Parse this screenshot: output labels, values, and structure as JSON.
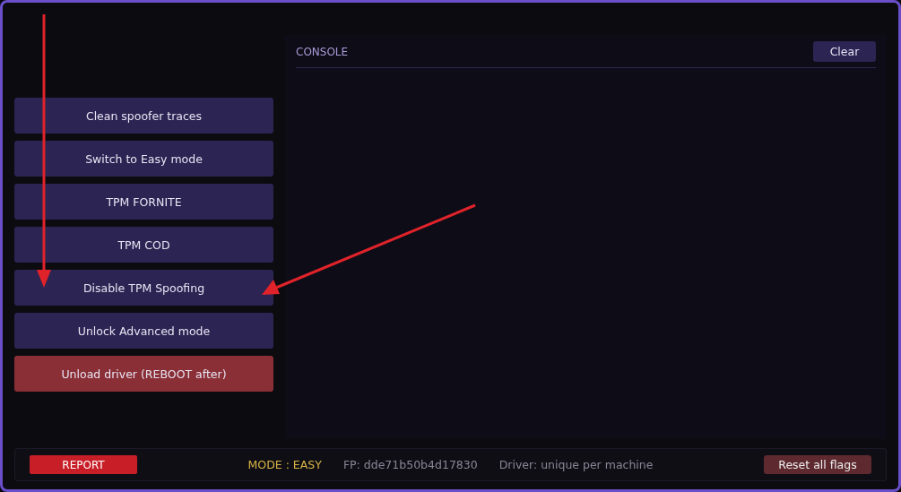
{
  "actions": [
    {
      "label": "Clean spoofer traces",
      "kind": "normal"
    },
    {
      "label": "Switch to Easy mode",
      "kind": "normal"
    },
    {
      "label": "TPM FORNITE",
      "kind": "normal"
    },
    {
      "label": "TPM COD",
      "kind": "normal"
    },
    {
      "label": "Disable TPM Spoofing",
      "kind": "normal"
    },
    {
      "label": "Unlock Advanced mode",
      "kind": "normal"
    },
    {
      "label": "Unload driver (REBOOT after)",
      "kind": "danger"
    }
  ],
  "console": {
    "title": "CONSOLE",
    "clear_button": "Clear"
  },
  "status_bar": {
    "report_button": "REPORT",
    "mode": "MODE : EASY",
    "fingerprint": "FP: dde71b50b4d17830",
    "driver": "Driver: unique per machine",
    "reset_button": "Reset all flags"
  }
}
